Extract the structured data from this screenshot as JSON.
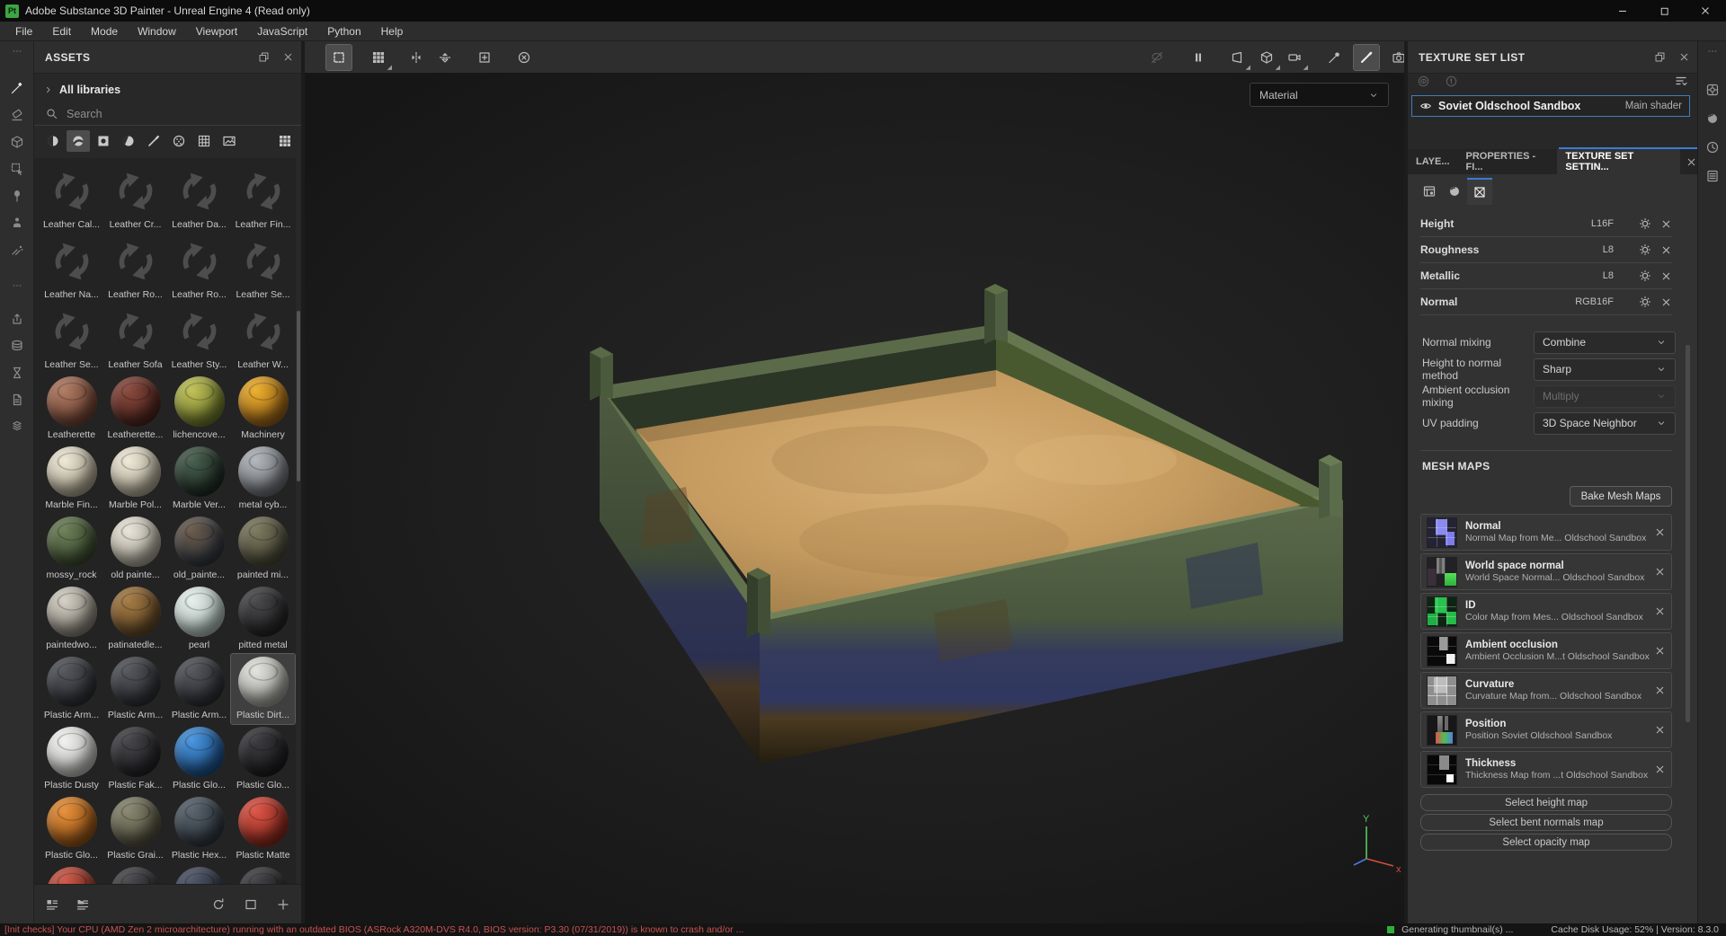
{
  "colors": {
    "accent_blue": "#3a7bd5",
    "selection_blue": "#3f7fbf",
    "warning_red": "#c75450",
    "status_green": "#2fae3c",
    "app_green": "#3DA542"
  },
  "window": {
    "title": "Adobe Substance 3D Painter - Unreal Engine 4 (Read only)",
    "app_icon_label": "Pt"
  },
  "menu": {
    "items": [
      "File",
      "Edit",
      "Mode",
      "Window",
      "Viewport",
      "JavaScript",
      "Python",
      "Help"
    ]
  },
  "left_toolbar": {
    "tools": [
      {
        "icon": "paint",
        "active": true
      },
      {
        "icon": "eraser"
      },
      {
        "icon": "projection"
      },
      {
        "icon": "polyfill"
      },
      {
        "icon": "smudge"
      },
      {
        "icon": "clone"
      },
      {
        "icon": "particle"
      }
    ],
    "shelf": [
      {
        "icon": "export"
      },
      {
        "icon": "stack"
      },
      {
        "icon": "hourglass"
      },
      {
        "icon": "docpage"
      },
      {
        "icon": "bundle"
      }
    ]
  },
  "assets": {
    "title": "ASSETS",
    "library_label": "All libraries",
    "search_placeholder": "Search",
    "filter_icons": [
      {
        "icon": "f-material",
        "name": "materials-filter"
      },
      {
        "icon": "f-smartmat",
        "name": "smart-materials-filter",
        "active": true
      },
      {
        "icon": "f-smartmask",
        "name": "smart-masks-filter"
      },
      {
        "icon": "f-filter",
        "name": "filters-filter"
      },
      {
        "icon": "f-brush",
        "name": "brushes-filter"
      },
      {
        "icon": "f-alpha",
        "name": "alphas-filter"
      },
      {
        "icon": "f-procedural",
        "name": "procedurals-filter"
      },
      {
        "icon": "f-texture",
        "name": "textures-filter"
      }
    ],
    "items": [
      {
        "label": "Leather Cal...",
        "type": "spinner"
      },
      {
        "label": "Leather Cr...",
        "type": "spinner"
      },
      {
        "label": "Leather Da...",
        "type": "spinner"
      },
      {
        "label": "Leather Fin...",
        "type": "spinner"
      },
      {
        "label": "Leather Na...",
        "type": "spinner"
      },
      {
        "label": "Leather Ro...",
        "type": "spinner"
      },
      {
        "label": "Leather Ro...",
        "type": "spinner"
      },
      {
        "label": "Leather Se...",
        "type": "spinner"
      },
      {
        "label": "Leather Se...",
        "type": "spinner"
      },
      {
        "label": "Leather Sofa",
        "type": "spinner"
      },
      {
        "label": "Leather Sty...",
        "type": "spinner"
      },
      {
        "label": "Leather W...",
        "type": "spinner"
      },
      {
        "label": "Leatherette",
        "type": "sphere",
        "c": [
          "#b07b63",
          "#5a3327"
        ]
      },
      {
        "label": "Leatherette...",
        "type": "sphere",
        "c": [
          "#8a4a3e",
          "#3c1a15"
        ]
      },
      {
        "label": "lichencove...",
        "type": "sphere",
        "c": [
          "#c2c257",
          "#55601f"
        ]
      },
      {
        "label": "Machinery",
        "type": "sphere",
        "c": [
          "#edb02e",
          "#7a4a10"
        ]
      },
      {
        "label": "Marble Fin...",
        "type": "sphere",
        "c": [
          "#efe9d8",
          "#8f8873"
        ]
      },
      {
        "label": "Marble Pol...",
        "type": "sphere",
        "c": [
          "#f0ead9",
          "#948d7b"
        ]
      },
      {
        "label": "Marble Ver...",
        "type": "sphere",
        "c": [
          "#49604f",
          "#141f19"
        ]
      },
      {
        "label": "metal cyb...",
        "type": "sphere",
        "c": [
          "#b4b8bd",
          "#53575c"
        ]
      },
      {
        "label": "mossy_rock",
        "type": "sphere",
        "c": [
          "#6d8058",
          "#2c3a24"
        ]
      },
      {
        "label": "old painte...",
        "type": "sphere",
        "c": [
          "#e9e5da",
          "#8e897c"
        ]
      },
      {
        "label": "old_painte...",
        "type": "sphere",
        "c": [
          "#6a5a4a",
          "#222c3a"
        ]
      },
      {
        "label": "painted mi...",
        "type": "sphere",
        "c": [
          "#7d7a60",
          "#3a392a"
        ]
      },
      {
        "label": "paintedwo...",
        "type": "sphere",
        "c": [
          "#d6d1c6",
          "#6e6960"
        ]
      },
      {
        "label": "patinatedle...",
        "type": "sphere",
        "c": [
          "#a67b45",
          "#4f3a1d"
        ]
      },
      {
        "label": "pearl",
        "type": "sphere",
        "c": [
          "#e8f0ec",
          "#93a49e"
        ]
      },
      {
        "label": "pitted metal",
        "type": "sphere",
        "c": [
          "#4a4a4c",
          "#1b1b1d"
        ]
      },
      {
        "label": "Plastic Arm...",
        "type": "sphere",
        "c": [
          "#54575c",
          "#222428"
        ]
      },
      {
        "label": "Plastic Arm...",
        "type": "sphere",
        "c": [
          "#54575c",
          "#222428"
        ]
      },
      {
        "label": "Plastic Arm...",
        "type": "sphere",
        "c": [
          "#54575c",
          "#222428"
        ]
      },
      {
        "label": "Plastic Dirt...",
        "type": "sphere",
        "c": [
          "#e4e4e0",
          "#86867f"
        ],
        "selected": true
      },
      {
        "label": "Plastic Dusty",
        "type": "sphere",
        "c": [
          "#f2f2f0",
          "#a2a29e"
        ]
      },
      {
        "label": "Plastic Fak...",
        "type": "sphere",
        "c": [
          "#46464a",
          "#1a1a1d"
        ]
      },
      {
        "label": "Plastic Glo...",
        "type": "sphere",
        "c": [
          "#4896e0",
          "#123a6a"
        ]
      },
      {
        "label": "Plastic Glo...",
        "type": "sphere",
        "c": [
          "#3c3c40",
          "#151517"
        ]
      },
      {
        "label": "Plastic Glo...",
        "type": "sphere",
        "c": [
          "#e8913a",
          "#77400e"
        ]
      },
      {
        "label": "Plastic Grai...",
        "type": "sphere",
        "c": [
          "#8a8872",
          "#403f2f"
        ]
      },
      {
        "label": "Plastic Hex...",
        "type": "sphere",
        "c": [
          "#59646e",
          "#232a31"
        ]
      },
      {
        "label": "Plastic Matte",
        "type": "sphere",
        "c": [
          "#de5548",
          "#6e1d12"
        ]
      },
      {
        "label": "",
        "type": "sphere",
        "c": [
          "#cf5a4a",
          "#5e1f12"
        ]
      },
      {
        "label": "",
        "type": "sphere",
        "c": [
          "#4a4a4e",
          "#1c1c1f"
        ]
      },
      {
        "label": "",
        "type": "sphere",
        "c": [
          "#4e5666",
          "#1e2230"
        ]
      },
      {
        "label": "",
        "type": "sphere",
        "c": [
          "#434347",
          "#19191c"
        ]
      }
    ],
    "footer_left": [
      {
        "icon": "listthumb",
        "name": "list-view-toggle"
      },
      {
        "icon": "listfolder",
        "name": "folder-view-toggle"
      }
    ],
    "footer_right": [
      {
        "icon": "refresh",
        "name": "refresh-assets"
      },
      {
        "icon": "framesel",
        "name": "frame-view"
      },
      {
        "icon": "plus",
        "name": "add-asset"
      }
    ]
  },
  "viewport": {
    "toolbar_left": [
      {
        "icon": "marquee",
        "name": "rectangle-select",
        "active": true
      },
      {
        "icon": "gridview",
        "name": "quick-select-grid",
        "caret": true
      },
      {
        "icon": "mirrorx",
        "name": "symmetry-x"
      },
      {
        "icon": "flipy",
        "name": "symmetry-y"
      },
      {
        "icon": "addframe",
        "name": "add-frame"
      },
      {
        "icon": "circlex",
        "name": "reset-view"
      }
    ],
    "toolbar_right": [
      {
        "icon": "lassooff",
        "name": "lasso-disabled",
        "disabled": true
      },
      {
        "icon": "pause",
        "name": "pause-engine"
      },
      {
        "icon": "persp",
        "name": "perspective-mode",
        "caret": true
      },
      {
        "icon": "cube",
        "name": "geometry-mode",
        "caret": true
      },
      {
        "icon": "videocam",
        "name": "camera-mode",
        "caret": true
      },
      {
        "icon": "paintdrop",
        "name": "physical-paint"
      },
      {
        "icon": "brushtool",
        "name": "paint-mode",
        "active": true
      },
      {
        "icon": "photocam",
        "name": "screenshot"
      }
    ],
    "material_dropdown": "Material",
    "gizmo": {
      "y": "Y",
      "x": "x"
    }
  },
  "texture_set_list": {
    "title": "TEXTURE SET LIST",
    "item": {
      "name": "Soviet Oldschool Sandbox",
      "shader": "Main shader"
    }
  },
  "tabs": {
    "items": [
      "LAYE...",
      "PROPERTIES - FI...",
      "TEXTURE SET SETTIN..."
    ],
    "active_index": 2
  },
  "tss": {
    "subtabs": [
      {
        "icon": "tabmaps",
        "name": "maps-subtab"
      },
      {
        "icon": "tabsphere",
        "name": "material-subtab"
      },
      {
        "icon": "tabmesh",
        "name": "mesh-subtab",
        "active": true
      }
    ],
    "channels": [
      {
        "name": "Height",
        "format": "L16F"
      },
      {
        "name": "Roughness",
        "format": "L8"
      },
      {
        "name": "Metallic",
        "format": "L8"
      },
      {
        "name": "Normal",
        "format": "RGB16F"
      }
    ],
    "settings": [
      {
        "label": "Normal mixing",
        "value": "Combine",
        "disabled": false
      },
      {
        "label": "Height to normal method",
        "value": "Sharp",
        "disabled": false
      },
      {
        "label": "Ambient occlusion mixing",
        "value": "Multiply",
        "disabled": true
      },
      {
        "label": "UV padding",
        "value": "3D Space Neighbor",
        "disabled": false
      }
    ],
    "mesh_maps_title": "MESH MAPS",
    "bake_button": "Bake Mesh Maps",
    "mesh_maps": [
      {
        "title": "Normal",
        "subtitle": "Normal Map from Me... Oldschool Sandbox",
        "thumb": "normal"
      },
      {
        "title": "World space normal",
        "subtitle": "World Space Normal... Oldschool Sandbox",
        "thumb": "wsn"
      },
      {
        "title": "ID",
        "subtitle": "Color Map from Mes... Oldschool Sandbox",
        "thumb": "id"
      },
      {
        "title": "Ambient occlusion",
        "subtitle": "Ambient Occlusion M...t Oldschool Sandbox",
        "thumb": "ao"
      },
      {
        "title": "Curvature",
        "subtitle": "Curvature Map from... Oldschool Sandbox",
        "thumb": "curv"
      },
      {
        "title": "Position",
        "subtitle": "Position Soviet Oldschool Sandbox",
        "thumb": "pos"
      },
      {
        "title": "Thickness",
        "subtitle": "Thickness Map from ...t Oldschool Sandbox",
        "thumb": "thick"
      }
    ],
    "select_buttons": [
      "Select height map",
      "Select bent normals map",
      "Select opacity map"
    ]
  },
  "right_strip": {
    "icons": [
      {
        "icon": "gearbox",
        "name": "display-settings"
      },
      {
        "icon": "tabsphere",
        "name": "shader-settings"
      },
      {
        "icon": "clock",
        "name": "history"
      },
      {
        "icon": "loglist",
        "name": "log"
      }
    ]
  },
  "statusbar": {
    "warning": "[Init checks] Your CPU (AMD Zen 2 microarchitecture) running with an outdated BIOS (ASRock A320M-DVS R4.0, BIOS version: P3.30 (07/31/2019)) is known to crash and/or ...",
    "generating": "Generating thumbnail(s) ...",
    "cache": "Cache Disk Usage:  52% | Version: 8.3.0"
  }
}
